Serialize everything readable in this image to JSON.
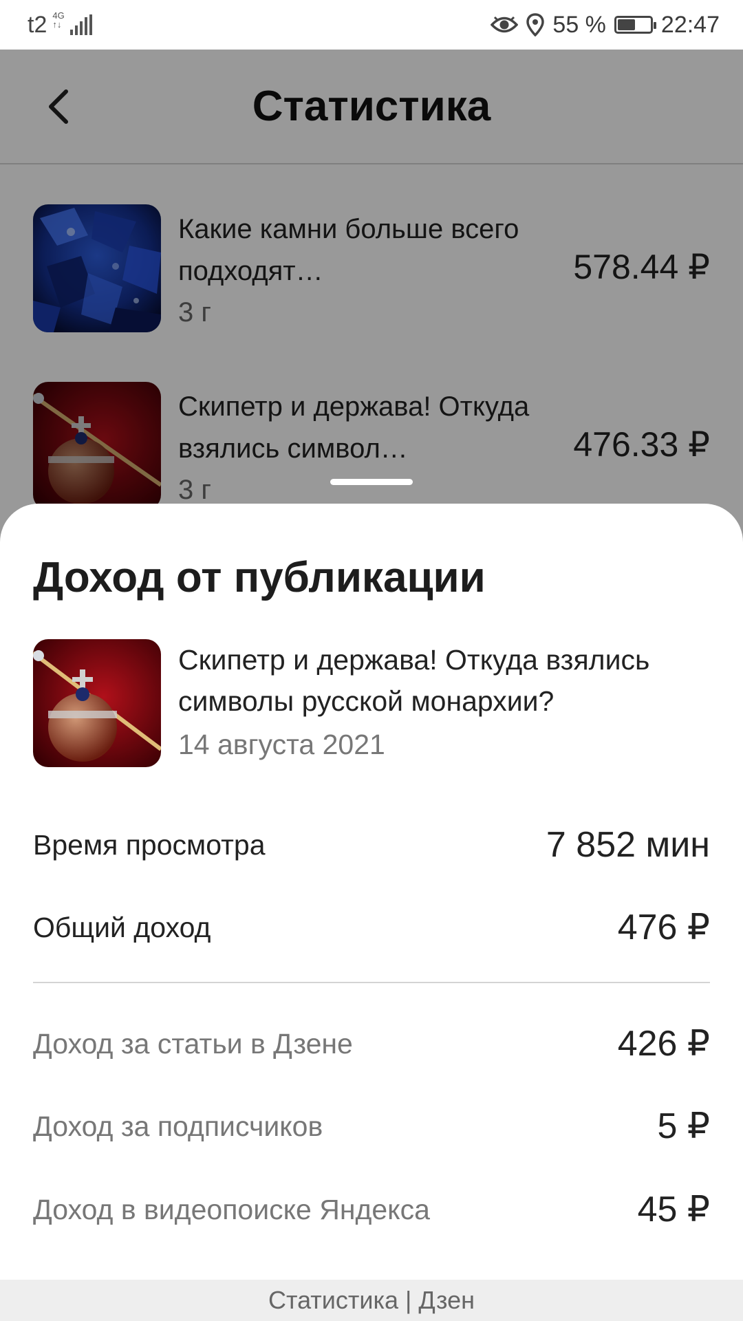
{
  "status_bar": {
    "carrier": "t2",
    "network_top": "4G",
    "network_bottom": "↑↓",
    "battery_percent": "55 %",
    "battery_level": 0.55,
    "time": "22:47",
    "icons": [
      "eye-icon",
      "location-pin-icon",
      "battery-icon"
    ]
  },
  "header": {
    "title": "Статистика",
    "back_icon": "chevron-left-icon"
  },
  "list": {
    "items": [
      {
        "title": "Какие камни больше всего подходят…",
        "age": "3 г",
        "amount": "578.44 ₽",
        "thumb": "blue-gems-thumbnail"
      },
      {
        "title": "Скипетр и держава! Откуда взялись символ…",
        "age": "3 г",
        "amount": "476.33 ₽",
        "thumb": "scepter-orb-thumbnail"
      }
    ]
  },
  "sheet": {
    "title": "Доход от публикации",
    "publication": {
      "title": "Скипетр и держава! Откуда взялись символы русской монархии?",
      "date": "14 августа 2021"
    },
    "stats": [
      {
        "label": "Время просмотра",
        "value": "7 852 мин"
      },
      {
        "label": "Общий доход",
        "value": "476 ₽"
      }
    ],
    "breakdown": [
      {
        "label": "Доход за статьи в Дзене",
        "value": "426 ₽"
      },
      {
        "label": "Доход за подписчиков",
        "value": "5 ₽"
      },
      {
        "label": "Доход в видеопоиске Яндекса",
        "value": "45 ₽"
      }
    ]
  },
  "footer": {
    "text": "Статистика | Дзен"
  },
  "colors": {
    "overlay": "#000000",
    "text_primary": "#222222",
    "text_secondary": "#777777",
    "divider": "#d4d4d4"
  }
}
